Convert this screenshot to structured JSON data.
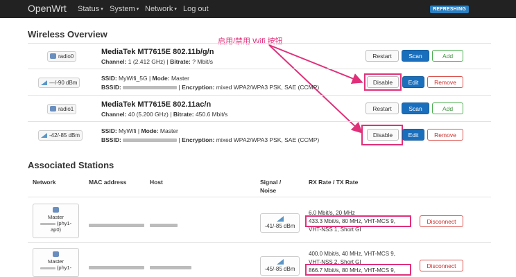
{
  "navbar": {
    "brand": "OpenWrt",
    "menu": [
      {
        "label": "Status",
        "caret": "▾"
      },
      {
        "label": "System",
        "caret": "▾"
      },
      {
        "label": "Network",
        "caret": "▾"
      },
      {
        "label": "Log out",
        "caret": ""
      }
    ],
    "status_badge": "REFRESHING"
  },
  "annotation": "启用/禁用 Wifi 按钮",
  "wireless": {
    "title": "Wireless Overview",
    "radios": [
      {
        "badge": "radio0",
        "name": "MediaTek MT7615E 802.11b/g/n",
        "channel_label": "Channel:",
        "channel": "1 (2.412 GHz)",
        "bitrate_label": "Bitrate:",
        "bitrate": "? Mbit/s",
        "buttons": {
          "restart": "Restart",
          "scan": "Scan",
          "add": "Add"
        },
        "network": {
          "signal_badge": "---/-90 dBm",
          "ssid_label": "SSID:",
          "ssid": "MyWifi_5G",
          "mode_label": "Mode:",
          "mode": "Master",
          "bssid_label": "BSSID:",
          "enc_label": "Encryption:",
          "encryption": "mixed WPA2/WPA3 PSK, SAE (CCMP)",
          "buttons": {
            "disable": "Disable",
            "edit": "Edit",
            "remove": "Remove"
          }
        }
      },
      {
        "badge": "radio1",
        "name": "MediaTek MT7615E 802.11ac/n",
        "channel_label": "Channel:",
        "channel": "40 (5.200 GHz)",
        "bitrate_label": "Bitrate:",
        "bitrate": "450.6 Mbit/s",
        "buttons": {
          "restart": "Restart",
          "scan": "Scan",
          "add": "Add"
        },
        "network": {
          "signal_badge": "-42/-85 dBm",
          "ssid_label": "SSID:",
          "ssid": "MyWifi",
          "mode_label": "Mode:",
          "mode": "Master",
          "bssid_label": "BSSID:",
          "enc_label": "Encryption:",
          "encryption": "mixed WPA2/WPA3 PSK, SAE (CCMP)",
          "buttons": {
            "disable": "Disable",
            "edit": "Edit",
            "remove": "Remove"
          }
        }
      }
    ]
  },
  "stations": {
    "title": "Associated Stations",
    "headers": {
      "network": "Network",
      "mac": "MAC address",
      "host": "Host",
      "signal": "Signal /",
      "noise": "Noise",
      "rate": "RX Rate / TX Rate"
    },
    "rows": [
      {
        "net_mode": "Master",
        "net_if": "(phy1-",
        "net_if2": "ap0)",
        "signal": "-41/-85 dBm",
        "rate_lines": [
          "6.0 Mbit/s, 20 MHz",
          "433.3 Mbit/s, 80 MHz, VHT-MCS 9,",
          "VHT-NSS 1, Short GI"
        ],
        "disconnect": "Disconnect"
      },
      {
        "net_mode": "Master",
        "net_if": "(phy1-",
        "net_if2": "",
        "signal": "-45/-85 dBm",
        "rate_lines": [
          "400.0 Mbit/s, 40 MHz, VHT-MCS 9,",
          "VHT-NSS 2, Short GI",
          "866.7 Mbit/s, 80 MHz, VHT-MCS 9,"
        ],
        "disconnect": "Disconnect"
      }
    ]
  },
  "colors": {
    "accent": "#e0307a",
    "primary": "#1a6fbd",
    "navbar": "#222222"
  }
}
